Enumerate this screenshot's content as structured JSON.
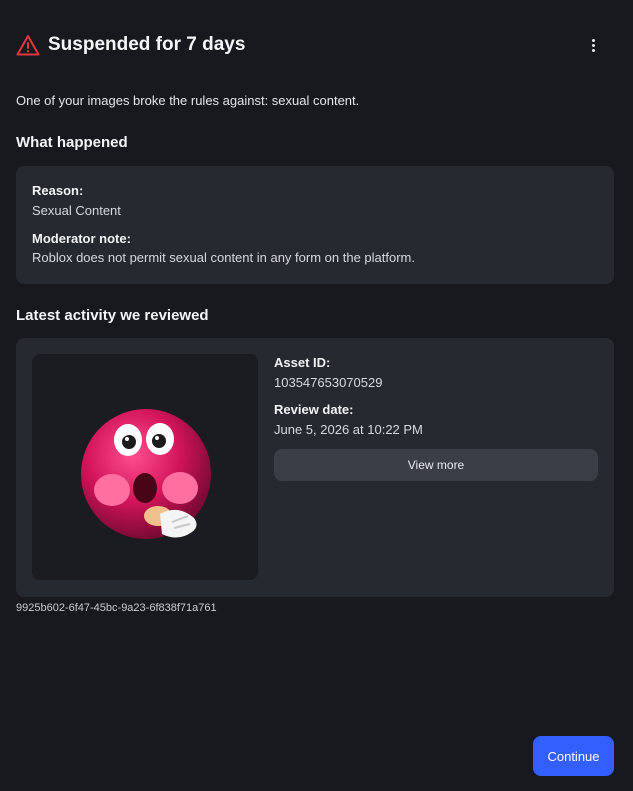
{
  "header": {
    "title": "Suspended for 7 days",
    "warning_icon": "warning-triangle-icon",
    "menu_icon": "more-vertical-icon"
  },
  "intro": "One of your images broke the rules against: sexual content.",
  "what_happened": {
    "heading": "What happened",
    "reason_label": "Reason:",
    "reason_value": "Sexual Content",
    "note_label": "Moderator note:",
    "note_value": "Roblox does not permit sexual content in any form on the platform."
  },
  "latest_activity": {
    "heading": "Latest activity we reviewed",
    "asset_id_label": "Asset ID:",
    "asset_id_value": "103547653070529",
    "review_date_label": "Review date:",
    "review_date_value": "June 5, 2026 at 10:22 PM",
    "view_more_label": "View more"
  },
  "reference_id": "9925b602-6f47-45bc-9a23-6f838f71a761",
  "footer": {
    "continue_label": "Continue"
  },
  "colors": {
    "background": "#18191e",
    "card": "#272931",
    "accent": "#335fff",
    "warning": "#e0383e"
  }
}
